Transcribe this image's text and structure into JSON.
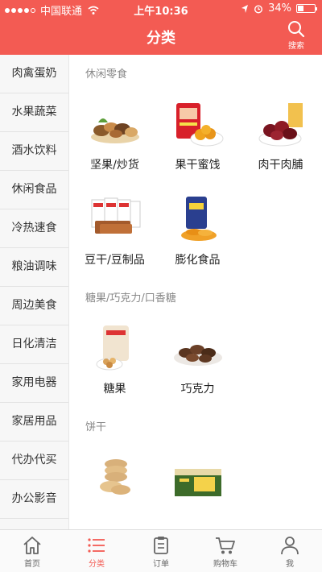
{
  "status": {
    "carrier": "中国联通",
    "time": "上午10:36",
    "battery": "34%",
    "battery_level": 0.34
  },
  "header": {
    "title": "分类",
    "search_label": "搜索"
  },
  "sidebar": {
    "items": [
      {
        "label": "肉禽蛋奶"
      },
      {
        "label": "水果蔬菜"
      },
      {
        "label": "酒水饮料"
      },
      {
        "label": "休闲食品"
      },
      {
        "label": "冷热速食"
      },
      {
        "label": "粮油调味"
      },
      {
        "label": "周边美食"
      },
      {
        "label": "日化清洁"
      },
      {
        "label": "家用电器"
      },
      {
        "label": "家居用品"
      },
      {
        "label": "代办代买"
      },
      {
        "label": "办公影音"
      }
    ],
    "active_index": 3
  },
  "content": {
    "sections": [
      {
        "title": "休闲零食",
        "products": [
          {
            "name": "坚果/炒货"
          },
          {
            "name": "果干蜜饯"
          },
          {
            "name": "肉干肉脯"
          },
          {
            "name": "豆干/豆制品"
          },
          {
            "name": "膨化食品"
          }
        ]
      },
      {
        "title": "糖果/巧克力/口香糖",
        "products": [
          {
            "name": "糖果"
          },
          {
            "name": "巧克力"
          }
        ]
      },
      {
        "title": "饼干",
        "products": [
          {
            "name": ""
          },
          {
            "name": ""
          }
        ]
      }
    ]
  },
  "tabbar": {
    "items": [
      {
        "label": "首页",
        "icon": "home-icon"
      },
      {
        "label": "分类",
        "icon": "list-icon"
      },
      {
        "label": "订单",
        "icon": "clipboard-icon"
      },
      {
        "label": "购物车",
        "icon": "cart-icon"
      },
      {
        "label": "我",
        "icon": "user-icon"
      }
    ],
    "active_index": 1
  },
  "colors": {
    "accent": "#f35b53",
    "sidebar_bg": "#f7f7f7",
    "tab_inactive": "#666666"
  }
}
